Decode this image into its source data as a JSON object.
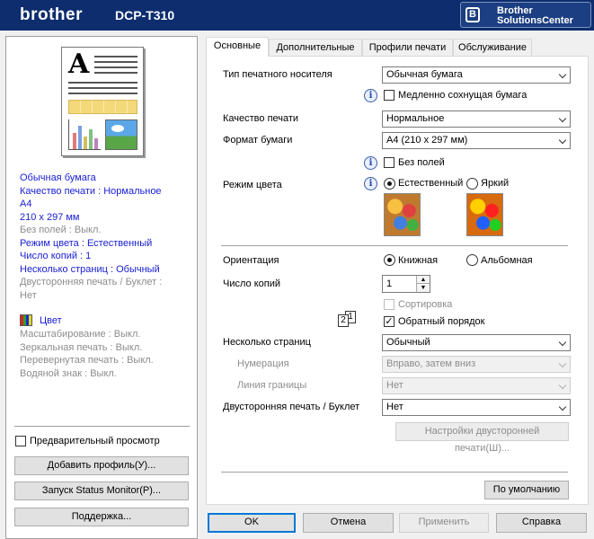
{
  "header": {
    "brand": "brother",
    "model": "DCP-T310",
    "bsc_line1": "Brother",
    "bsc_line2": "SolutionsCenter",
    "bsc_icon": "B"
  },
  "summary": {
    "lines": [
      {
        "text": "Обычная бумага",
        "style": "blue"
      },
      {
        "text": "Качество печати : Нормальное",
        "style": "blue"
      },
      {
        "text": "A4",
        "style": "blue"
      },
      {
        "text": "210 x 297 мм",
        "style": "blue"
      },
      {
        "text": "Без полей : Выкл.",
        "style": "gray"
      },
      {
        "text": "Режим цвета : Естественный",
        "style": "blue"
      },
      {
        "text": "Число копий : 1",
        "style": "blue"
      },
      {
        "text": "Несколько страниц : Обычный",
        "style": "blue"
      },
      {
        "text": "Двусторонняя печать / Буклет :",
        "style": "gray"
      },
      {
        "text": "Нет",
        "style": "gray"
      }
    ],
    "color_label": "Цвет",
    "extra": [
      "Масштабирование : Выкл.",
      "Зеркальная печать : Выкл.",
      "Перевернутая печать : Выкл.",
      "Водяной знак : Выкл."
    ]
  },
  "left": {
    "preview_label": "Предварительный просмотр",
    "add_profile": "Добавить профиль(У)...",
    "status_monitor": "Запуск Status Monitor(P)...",
    "support": "Поддержка..."
  },
  "tabs": [
    "Основные",
    "Дополнительные",
    "Профили печати",
    "Обслуживание"
  ],
  "basic": {
    "media_label": "Тип печатного носителя",
    "media_value": "Обычная бумага",
    "slow_dry": "Медленно сохнущая бумага",
    "quality_label": "Качество печати",
    "quality_value": "Нормальное",
    "paper_label": "Формат бумаги",
    "paper_value": "A4 (210 x 297 мм)",
    "borderless": "Без полей",
    "color_mode_label": "Режим цвета",
    "color_natural": "Естественный",
    "color_vivid": "Яркий",
    "orientation_label": "Ориентация",
    "portrait": "Книжная",
    "landscape": "Альбомная",
    "copies_label": "Число копий",
    "copies_value": "1",
    "collate": "Сортировка",
    "reverse": "Обратный порядок",
    "multipage_label": "Несколько страниц",
    "multipage_value": "Обычный",
    "order_label": "Нумерация",
    "order_value": "Вправо, затем вниз",
    "border_label": "Линия границы",
    "border_value": "Нет",
    "duplex_label": "Двусторонняя печать / Буклет",
    "duplex_value": "Нет",
    "duplex_settings": "Настройки двусторонней печати(Ш)...",
    "defaults": "По умолчанию",
    "info_glyph": "i",
    "page_num_2": "2",
    "page_num_1": "1"
  },
  "footer": {
    "ok": "OK",
    "cancel": "Отмена",
    "apply": "Применить",
    "help": "Справка"
  },
  "colors": {
    "header": "#0d2d6e",
    "summary_blue": "#1b20d4",
    "disabled": "#8d8d8d"
  }
}
